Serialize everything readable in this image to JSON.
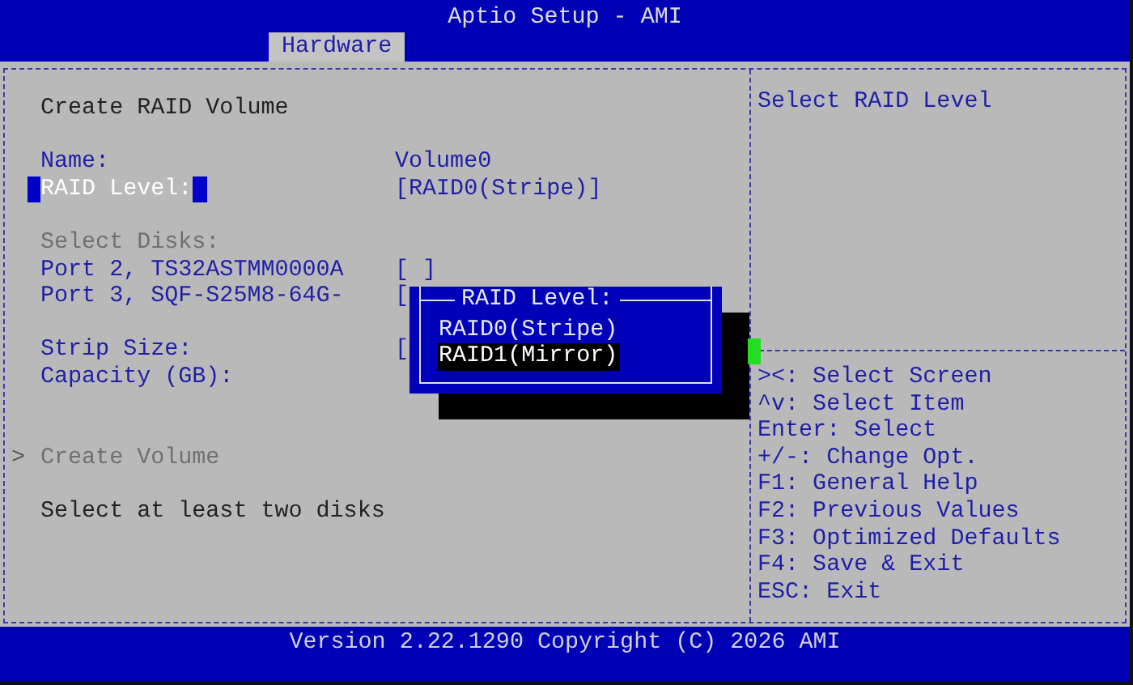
{
  "window": {
    "title": "Aptio Setup - AMI"
  },
  "tabs": [
    {
      "label": "Hardware",
      "selected": true
    }
  ],
  "form": {
    "title": "Create RAID Volume",
    "items": [
      {
        "kind": "blank"
      },
      {
        "kind": "field",
        "label": "Name:",
        "value": "Volume0",
        "selected": false,
        "disabled": false
      },
      {
        "kind": "field",
        "label": "RAID Level:",
        "value": "[RAID0(Stripe)]",
        "selected": true,
        "disabled": false
      },
      {
        "kind": "blank"
      },
      {
        "kind": "field",
        "label": "Select Disks:",
        "selected": false,
        "disabled": true
      },
      {
        "kind": "field",
        "label": "Port 2, TS32ASTMM0000A",
        "value": "[ ]",
        "selected": false,
        "disabled": false
      },
      {
        "kind": "field",
        "label": "Port 3, SQF-S25M8-64G-",
        "value": "[",
        "selected": false,
        "disabled": false
      },
      {
        "kind": "blank"
      },
      {
        "kind": "field",
        "label": "Strip Size:",
        "value": "[",
        "selected": false,
        "disabled": false
      },
      {
        "kind": "field",
        "label": "Capacity (GB):",
        "selected": false,
        "disabled": false
      },
      {
        "kind": "blank"
      },
      {
        "kind": "blank"
      },
      {
        "kind": "action",
        "label": "Create Volume",
        "marker": ">",
        "selected": false,
        "disabled": true
      },
      {
        "kind": "blank"
      },
      {
        "kind": "note",
        "label": "Select at least two disks"
      }
    ]
  },
  "help": {
    "text": "Select RAID Level",
    "keys": [
      "><: Select Screen",
      "^v: Select Item",
      "Enter: Select",
      "+/-: Change Opt.",
      "F1: General Help",
      "F2: Previous Values",
      "F3: Optimized Defaults",
      "F4: Save & Exit",
      "ESC: Exit"
    ]
  },
  "popup": {
    "title": "RAID Level:",
    "options": [
      {
        "label": "RAID0(Stripe)",
        "selected": false
      },
      {
        "label": "RAID1(Mirror)",
        "selected": true
      }
    ]
  },
  "status_bar": {
    "text": "Version 2.22.1290 Copyright (C) 2026 AMI"
  }
}
